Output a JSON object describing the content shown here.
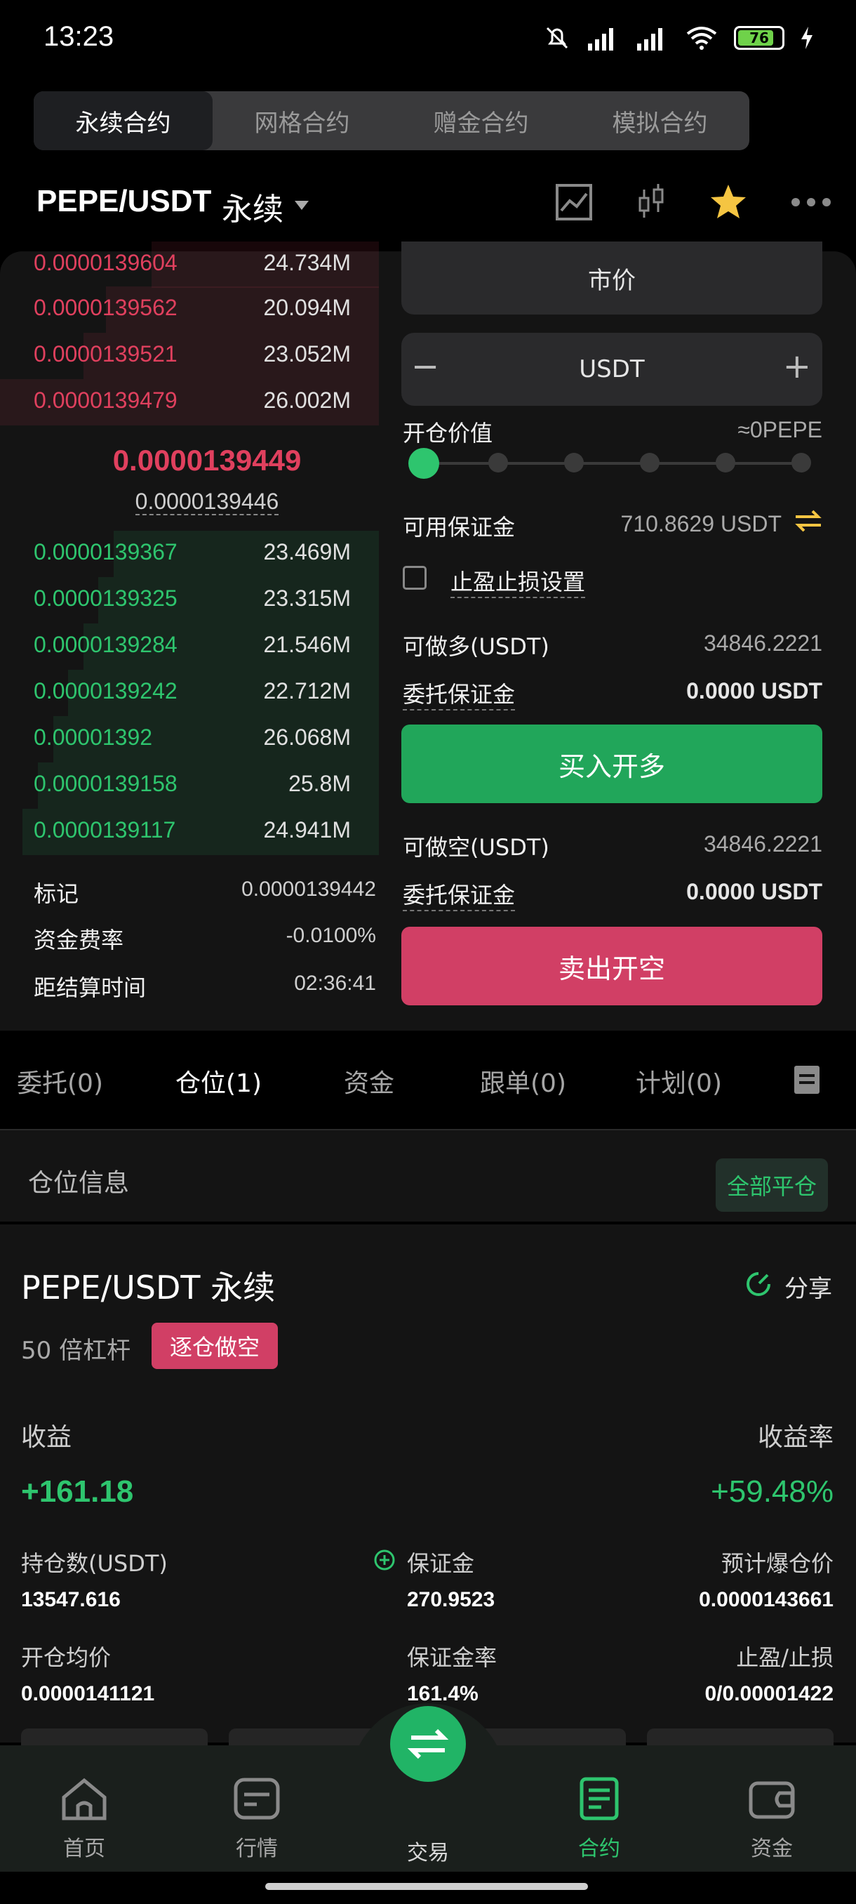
{
  "status_bar": {
    "time": "13:23",
    "battery": "76"
  },
  "top_tabs": [
    "永续合约",
    "网格合约",
    "赠金合约",
    "模拟合约"
  ],
  "header": {
    "pair": "PEPE/USDT",
    "type": "永续"
  },
  "order_book": {
    "asks": [
      {
        "price": "0.0000139604",
        "qty": "24.734M"
      },
      {
        "price": "0.0000139562",
        "qty": "20.094M"
      },
      {
        "price": "0.0000139521",
        "qty": "23.052M"
      },
      {
        "price": "0.0000139479",
        "qty": "26.002M"
      }
    ],
    "last_price": "0.0000139449",
    "mark_price": "0.0000139446",
    "bids": [
      {
        "price": "0.0000139367",
        "qty": "23.469M"
      },
      {
        "price": "0.0000139325",
        "qty": "23.315M"
      },
      {
        "price": "0.0000139284",
        "qty": "21.546M"
      },
      {
        "price": "0.0000139242",
        "qty": "22.712M"
      },
      {
        "price": "0.00001392",
        "qty": "26.068M"
      },
      {
        "price": "0.0000139158",
        "qty": "25.8M"
      },
      {
        "price": "0.0000139117",
        "qty": "24.941M"
      }
    ],
    "info": [
      {
        "label": "标记",
        "value": "0.0000139442"
      },
      {
        "label": "资金费率",
        "value": "-0.0100%"
      },
      {
        "label": "距结算时间",
        "value": "02:36:41"
      }
    ]
  },
  "form": {
    "order_type": "市价",
    "amount_unit": "USDT",
    "minus": "−",
    "plus": "+",
    "open_value_label": "开仓价值",
    "open_value": "≈0PEPE",
    "available_label": "可用保证金",
    "available": "710.8629 USDT",
    "tpsl_label": "止盈止损设置",
    "long_max_label": "可做多(USDT)",
    "long_max": "34846.2221",
    "long_margin_label": "委托保证金",
    "long_margin": "0.0000 USDT",
    "buy_label": "买入开多",
    "short_max_label": "可做空(USDT)",
    "short_max": "34846.2221",
    "short_margin_label": "委托保证金",
    "short_margin": "0.0000 USDT",
    "sell_label": "卖出开空"
  },
  "sub_tabs": [
    "委托(0)",
    "仓位(1)",
    "资金",
    "跟单(0)",
    "计划(0)"
  ],
  "position": {
    "section_title": "仓位信息",
    "close_all": "全部平仓",
    "pair": "PEPE/USDT 永续",
    "share": "分享",
    "leverage": "50 倍杠杆",
    "mode": "逐仓做空",
    "pnl_label": "收益",
    "pnl_rate_label": "收益率",
    "pnl": "+161.18",
    "pnl_rate": "+59.48%",
    "fields": [
      {
        "label": "持仓数(USDT)",
        "value": "13547.616"
      },
      {
        "label": "保证金",
        "value": "270.9523"
      },
      {
        "label": "预计爆仓价",
        "value": "0.0000143661"
      },
      {
        "label": "开仓均价",
        "value": "0.0000141121"
      },
      {
        "label": "保证金率",
        "value": "161.4%"
      },
      {
        "label": "止盈/止损",
        "value": "0/0.00001422"
      }
    ]
  },
  "bottom_nav": [
    "首页",
    "行情",
    "交易",
    "合约",
    "资金"
  ],
  "colors": {
    "green": "#2ec56e",
    "red": "#e0405e",
    "bg": "#141414"
  }
}
